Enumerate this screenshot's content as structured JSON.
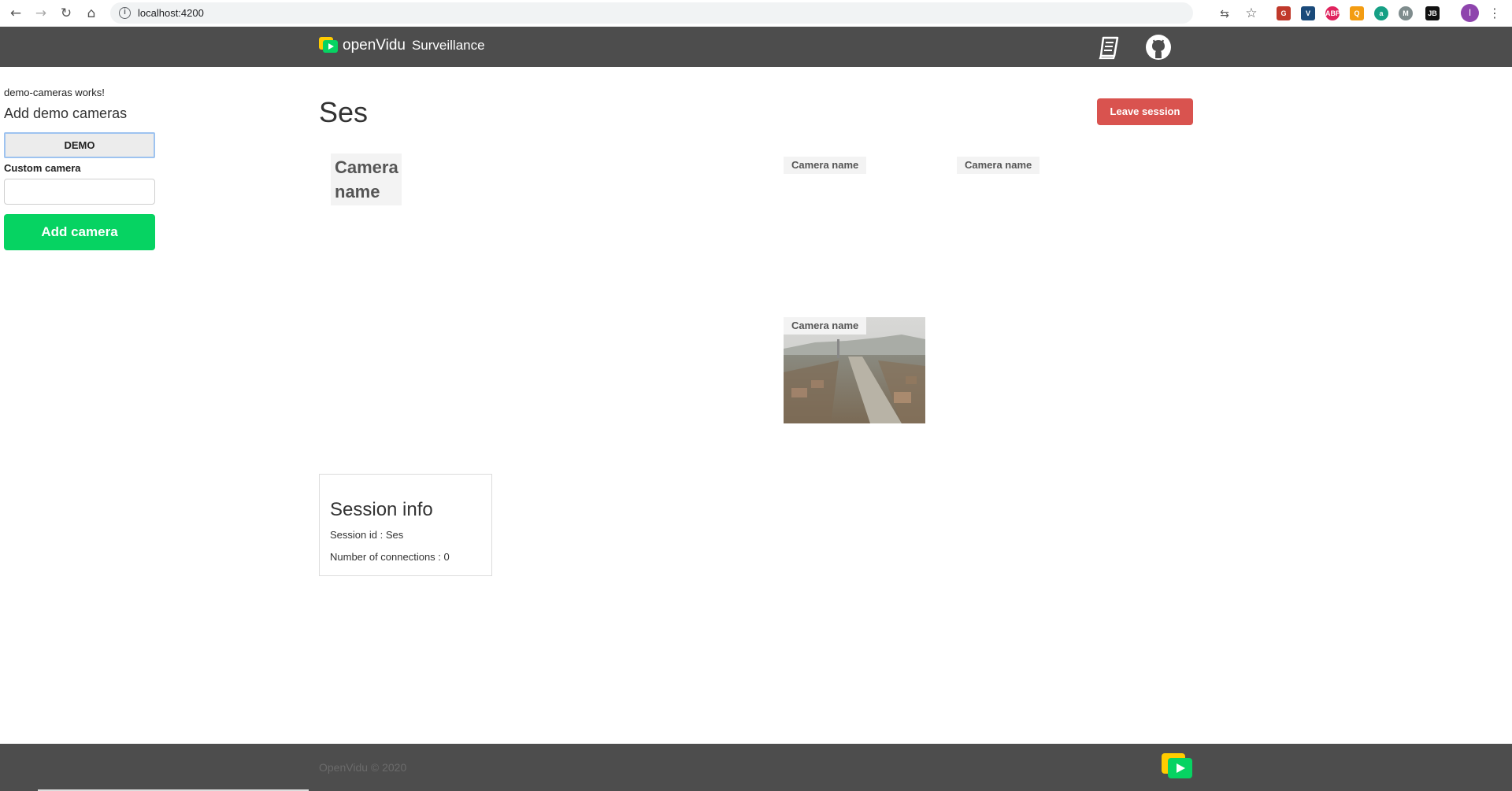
{
  "browser": {
    "url": "localhost:4200",
    "profile_initial": "I",
    "extensions": [
      {
        "name": "translate-icon",
        "color": "#c0392b",
        "text": "G"
      },
      {
        "name": "vimeo-icon",
        "color": "#1a4a7a",
        "text": "V"
      },
      {
        "name": "adblock-icon",
        "color": "#e0245e",
        "text": "ABP"
      },
      {
        "name": "search-extension-icon",
        "color": "#f39c12",
        "text": "Q"
      },
      {
        "name": "grammar-extension-icon",
        "color": "#16a085",
        "text": "a"
      },
      {
        "name": "m-extension-icon",
        "color": "#7f8c8d",
        "text": "M"
      },
      {
        "name": "jb-extension-icon",
        "color": "#111111",
        "text": "JB"
      }
    ]
  },
  "header": {
    "brand": "openVidu",
    "subtitle": "Surveillance"
  },
  "sidebar": {
    "works_text": "demo-cameras works!",
    "title": "Add demo cameras",
    "demo_button": "DEMO",
    "custom_label": "Custom camera",
    "custom_value": "",
    "add_button": "Add camera"
  },
  "main": {
    "session_title": "Ses",
    "leave_button": "Leave session",
    "cameras": [
      {
        "label": "Camera name"
      },
      {
        "label": "Camera name"
      },
      {
        "label": "Camera name"
      },
      {
        "label": "Camera name"
      }
    ]
  },
  "session_info": {
    "title": "Session info",
    "session_id_line": "Session id : Ses",
    "connections_line": "Number of connections : 0"
  },
  "footer": {
    "text": "OpenVidu © 2020"
  },
  "colors": {
    "header_bg": "#4d4d4d",
    "brand_green": "#06d362",
    "brand_yellow": "#ffcc00",
    "leave_red": "#d9534f"
  }
}
